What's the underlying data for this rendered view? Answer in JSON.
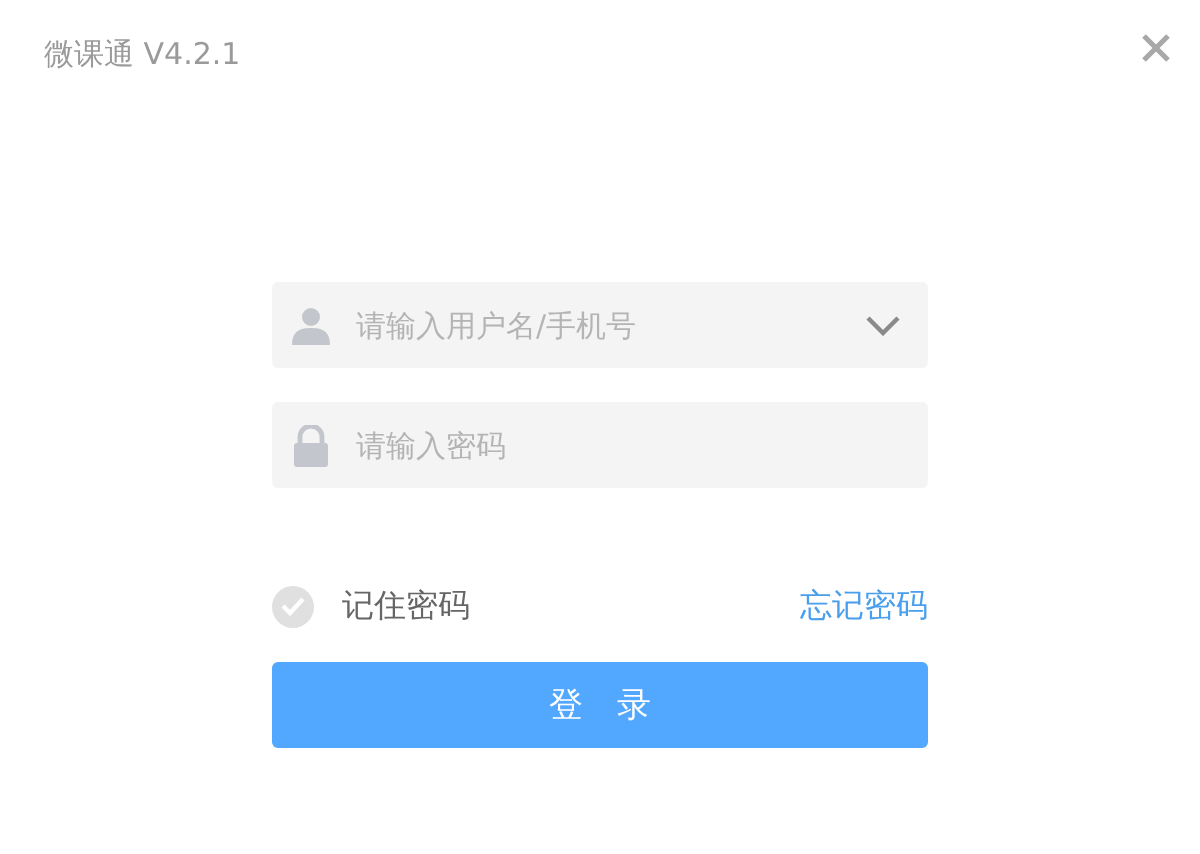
{
  "window": {
    "title": "微课通 V4.2.1"
  },
  "username": {
    "placeholder": "请输入用户名/手机号"
  },
  "password": {
    "placeholder": "请输入密码"
  },
  "remember": {
    "label": "记住密码",
    "checked": false
  },
  "forgot_link": "忘记密码",
  "login_button": "登　录"
}
